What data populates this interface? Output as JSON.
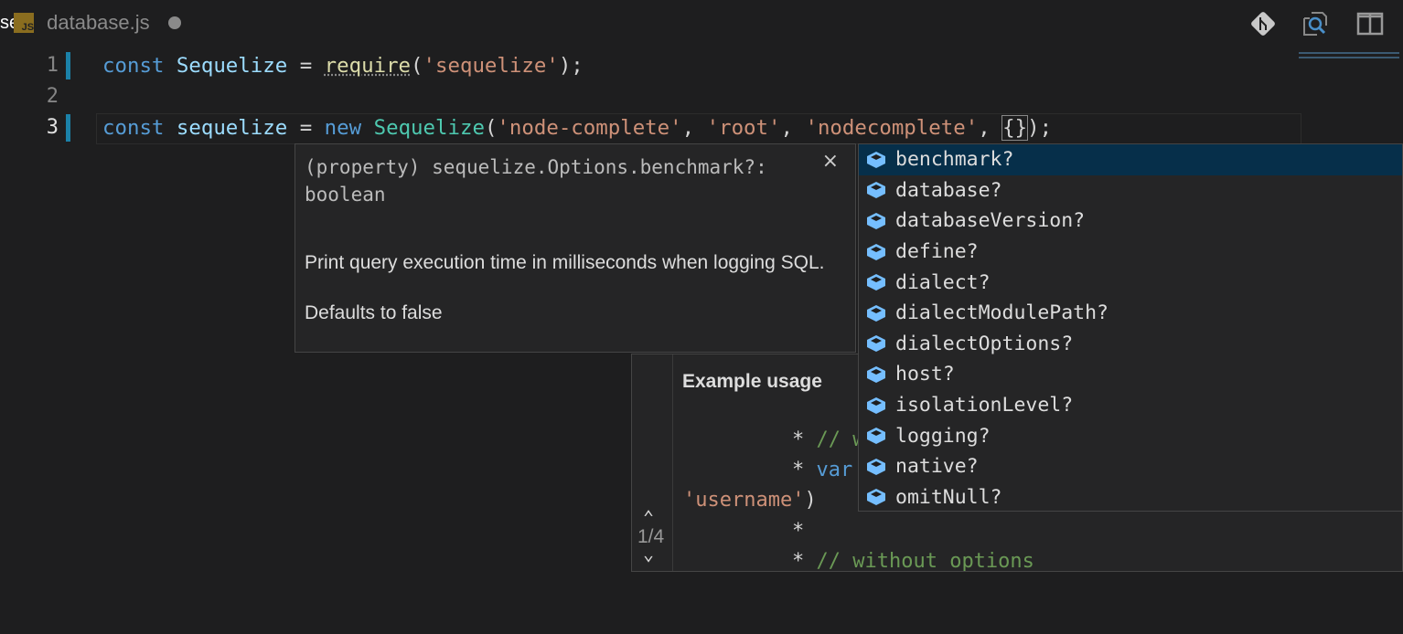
{
  "tab": {
    "prefix": "se",
    "icon_label": "JS",
    "filename": "database.js"
  },
  "toolbar": {
    "icons": [
      "git-icon",
      "open-preview-icon",
      "split-editor-icon"
    ]
  },
  "editor": {
    "line_numbers": [
      "1",
      "2",
      "3"
    ],
    "line1": [
      "const",
      " ",
      "Sequelize",
      " = ",
      "require",
      "(",
      "'sequelize'",
      ");"
    ],
    "line3": [
      "const",
      " ",
      "sequelize",
      " = ",
      "new",
      " ",
      "Sequelize",
      "(",
      "'node-complete'",
      ", ",
      "'root'",
      ", ",
      "'nodecomplete'",
      ", ",
      "{}",
      ");"
    ]
  },
  "hover": {
    "signature": "(property) sequelize.Options.benchmark?: boolean",
    "description": "Print query execution time in milliseconds when logging SQL.",
    "default": "Defaults to false",
    "close": "×"
  },
  "details": {
    "heading": "Example usage",
    "lines": [
      [
        "* ",
        "// w"
      ],
      [
        "* ",
        "var"
      ],
      [
        "'username'",
        ")"
      ],
      [
        "*",
        ""
      ],
      [
        "* ",
        "// without options"
      ]
    ],
    "page": "1/4",
    "up": "⌃",
    "down": "⌄"
  },
  "suggest": {
    "items": [
      "benchmark?",
      "database?",
      "databaseVersion?",
      "define?",
      "dialect?",
      "dialectModulePath?",
      "dialectOptions?",
      "host?",
      "isolationLevel?",
      "logging?",
      "native?",
      "omitNull?"
    ],
    "selected_index": 0
  }
}
